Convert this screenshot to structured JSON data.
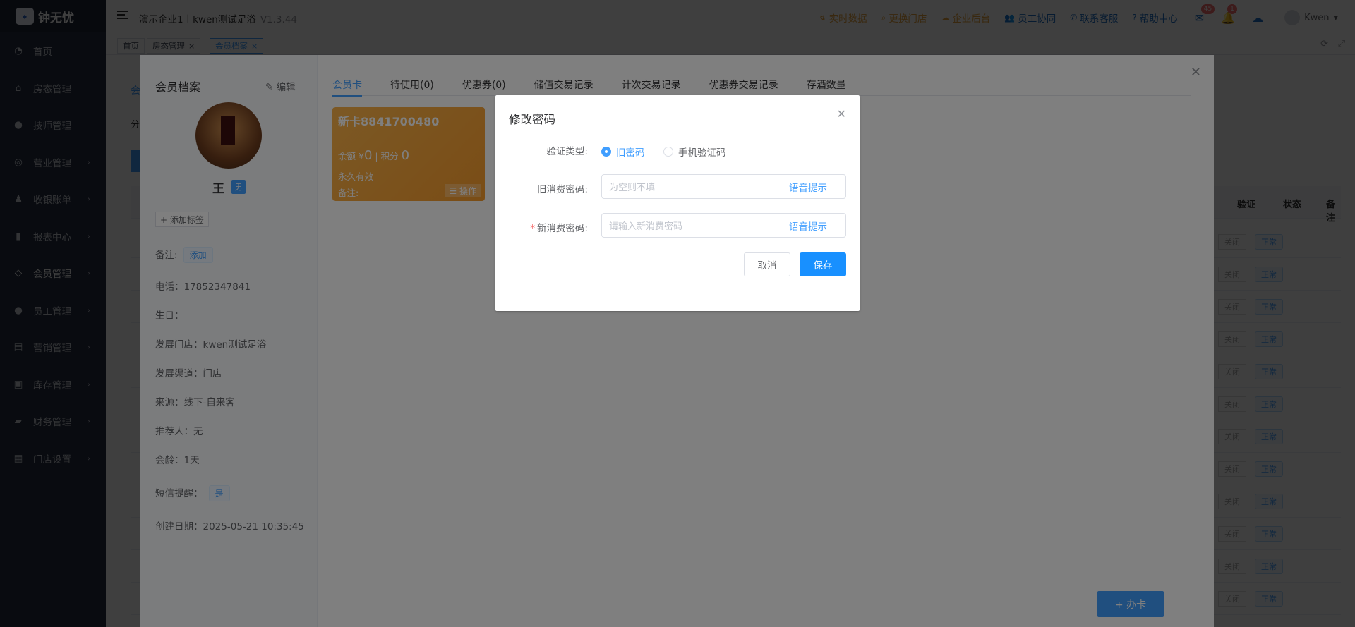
{
  "app": {
    "logo_text": "钟无忧",
    "logo_mark": "钟无忧",
    "company_title": "演示企业1丨kwen测试足浴",
    "version": "V1.3.44"
  },
  "sidebar": {
    "items": [
      {
        "label": "首页",
        "icon": "dashboard-icon"
      },
      {
        "label": "房态管理",
        "icon": "home-icon"
      },
      {
        "label": "技师管理",
        "icon": "user-icon"
      },
      {
        "label": "营业管理",
        "icon": "target-icon"
      },
      {
        "label": "收银账单",
        "icon": "moneybag-icon"
      },
      {
        "label": "报表中心",
        "icon": "bar-chart-icon"
      },
      {
        "label": "会员管理",
        "icon": "diamond-icon"
      },
      {
        "label": "员工管理",
        "icon": "user-icon"
      },
      {
        "label": "营销管理",
        "icon": "briefcase-icon"
      },
      {
        "label": "库存管理",
        "icon": "box-icon"
      },
      {
        "label": "财务管理",
        "icon": "wallet-icon"
      },
      {
        "label": "门店设置",
        "icon": "grid-icon"
      }
    ]
  },
  "header": {
    "actions": [
      {
        "label": "实时数据",
        "icon": "chart-line-icon"
      },
      {
        "label": "更换门店",
        "icon": "search-icon"
      },
      {
        "label": "企业后台",
        "icon": "cloud-icon"
      },
      {
        "label": "员工协同",
        "icon": "users-icon"
      },
      {
        "label": "联系客服",
        "icon": "phone-icon"
      },
      {
        "label": "帮助中心",
        "icon": "help-icon"
      }
    ],
    "mail_badge": "45",
    "bell_badge": "1",
    "user_name": "Kwen"
  },
  "tags": {
    "items": [
      "首页",
      "房态管理",
      "会员档案"
    ]
  },
  "background_table": {
    "headers": [
      "验证",
      "状态",
      "备注"
    ],
    "status": "正常",
    "close_label": "关闭",
    "side_tab": "会",
    "side_label": "分"
  },
  "drawer": {
    "title": "会员档案",
    "edit_label": "编辑",
    "name": "王",
    "gender": "男",
    "add_tag": "+ 添加标签",
    "remark_label": "备注:",
    "remark_action": "添加",
    "phone": "电话：17852347841",
    "birthday": "生日：",
    "store": "发展门店：kwen测试足浴",
    "channel": "发展渠道：门店",
    "source": "来源：线下-自来客",
    "referrer": "推荐人：无",
    "age": "会龄：1天",
    "sms_label": "短信提醒：",
    "sms_value": "是",
    "created": "创建日期：2025-05-21 10:35:45",
    "tabs": [
      "会员卡",
      "待使用(0)",
      "优惠券(0)",
      "储值交易记录",
      "计次交易记录",
      "优惠券交易记录",
      "存酒数量"
    ],
    "card": {
      "name": "新卡8841700480",
      "balance_label": "余额 ¥",
      "balance": "0",
      "points_label": "积分",
      "points": "0",
      "validity": "永久有效",
      "note": "备注:",
      "operate": "☰ 操作"
    },
    "fab": "+ 办卡"
  },
  "dialog": {
    "title": "修改密码",
    "verify_label": "验证类型:",
    "radio_old": "旧密码",
    "radio_sms": "手机验证码",
    "old_label": "旧消费密码:",
    "old_placeholder": "为空则不填",
    "new_label": "新消费密码:",
    "new_placeholder": "请输入新消费密码",
    "voice_hint": "语音提示",
    "cancel": "取消",
    "save": "保存"
  },
  "colors": {
    "accent": "#409eff",
    "sidebar_bg": "#242e42",
    "warning": "#e6a23c",
    "card_orange": "#f8a83a"
  }
}
